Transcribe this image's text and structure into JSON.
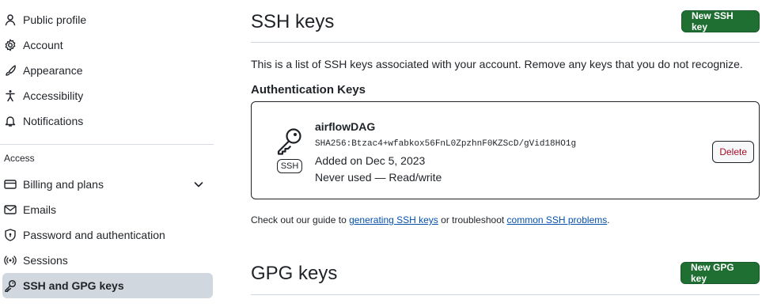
{
  "sidebar": {
    "items": [
      {
        "label": "Public profile",
        "icon": "person-icon"
      },
      {
        "label": "Account",
        "icon": "gear-icon"
      },
      {
        "label": "Appearance",
        "icon": "paintbrush-icon"
      },
      {
        "label": "Accessibility",
        "icon": "accessibility-icon"
      },
      {
        "label": "Notifications",
        "icon": "bell-icon"
      }
    ],
    "section_access": "Access",
    "access_items": [
      {
        "label": "Billing and plans",
        "icon": "credit-card-icon",
        "has_chevron": true
      },
      {
        "label": "Emails",
        "icon": "mail-icon"
      },
      {
        "label": "Password and authentication",
        "icon": "shield-lock-icon"
      },
      {
        "label": "Sessions",
        "icon": "broadcast-icon"
      },
      {
        "label": "SSH and GPG keys",
        "icon": "key-icon",
        "active": true
      }
    ]
  },
  "ssh": {
    "title": "SSH keys",
    "new_button": "New SSH key",
    "description": "This is a list of SSH keys associated with your account. Remove any keys that you do not recognize.",
    "auth_heading": "Authentication Keys",
    "key": {
      "name": "airflowDAG",
      "fingerprint": "SHA256:Btzac4+wfabkox56FnL0ZpzhnF0KZScD/gVid18HO1g",
      "added": "Added on Dec 5, 2023",
      "usage": "Never used — Read/write",
      "badge": "SSH",
      "delete_label": "Delete"
    },
    "guide": {
      "prefix": "Check out our guide to ",
      "link1": "generating SSH keys",
      "middle": " or troubleshoot ",
      "link2": "common SSH problems",
      "suffix": "."
    }
  },
  "gpg": {
    "title": "GPG keys",
    "new_button": "New GPG key"
  },
  "colors": {
    "primary_button": "#1f6f33",
    "active_nav": "#d0d7de",
    "danger_text": "#a40e26",
    "link": "#0550ae"
  }
}
